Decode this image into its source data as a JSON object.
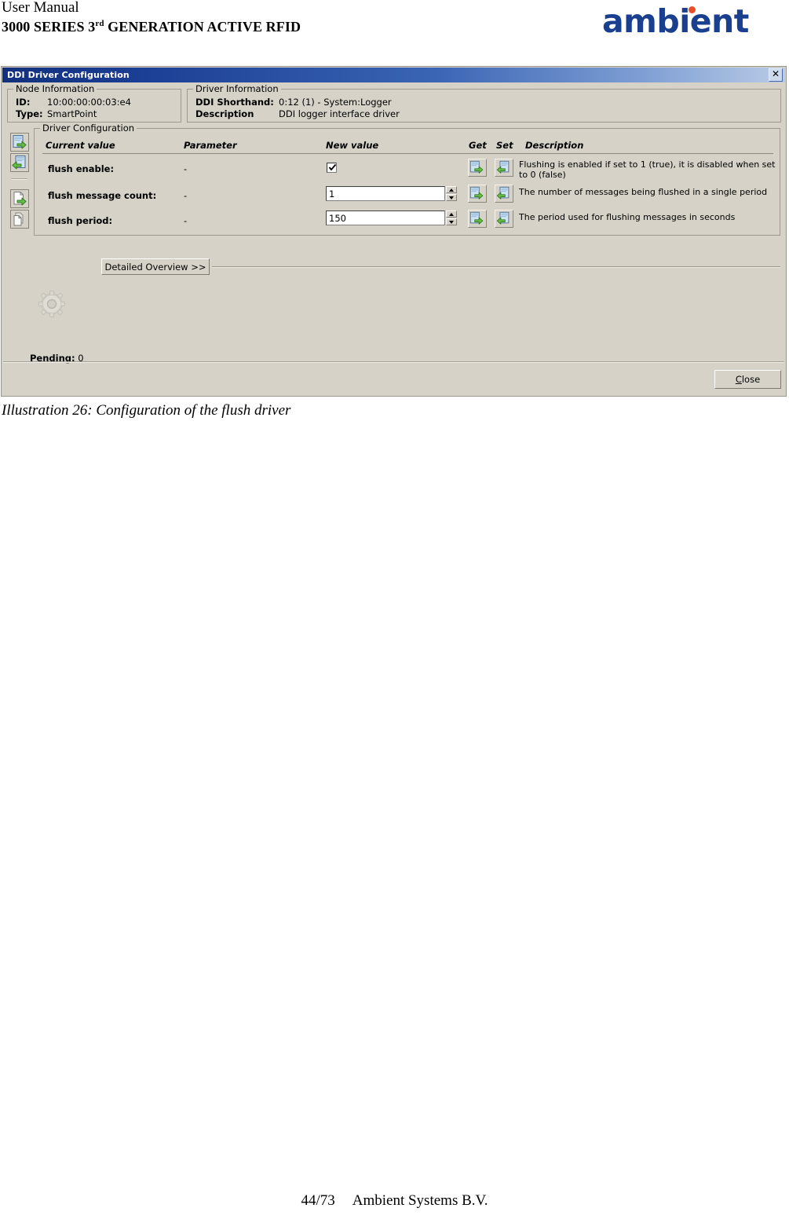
{
  "page": {
    "header_line1": "User Manual",
    "header_line2_prefix": "3000 SERIES 3",
    "header_line2_sup": "rd",
    "header_line2_suffix": " GENERATION ACTIVE RFID",
    "logo_text": "ambient",
    "logo_color": "#1b3f8f",
    "logo_dot_color": "#e8502a",
    "caption": "Illustration 26: Configuration of the flush driver",
    "footer_page": "44/73",
    "footer_company": "Ambient Systems B.V."
  },
  "dialog": {
    "title": "DDI Driver Configuration",
    "close_icon_label": "✕",
    "titlebar_color": "#1b3f94",
    "face_color": "#d6d2c8",
    "node_information": {
      "legend": "Node Information",
      "rows": [
        {
          "key": "ID:",
          "value": "10:00:00:00:03:e4"
        },
        {
          "key": "Type:",
          "value": "SmartPoint"
        }
      ]
    },
    "driver_information": {
      "legend": "Driver Information",
      "rows": [
        {
          "key": "DDI Shorthand:",
          "value": "0:12 (1) - System:Logger"
        },
        {
          "key": "Description",
          "value": "DDI logger interface driver"
        }
      ]
    },
    "toolbar": {
      "buttons": [
        {
          "name": "get-all-button",
          "icon": "page-right-arrow-icon"
        },
        {
          "name": "set-all-button",
          "icon": "page-left-arrow-icon"
        },
        {
          "name": "export-button",
          "icon": "document-right-arrow-icon"
        },
        {
          "name": "copy-button",
          "icon": "copy-pages-icon"
        }
      ]
    },
    "driver_configuration": {
      "legend": "Driver Configuration",
      "columns": [
        "Current value",
        "Parameter",
        "New value",
        "Get",
        "Set",
        "Description"
      ],
      "rows": [
        {
          "current_value": "flush enable:",
          "parameter": "-",
          "new_value": "",
          "control": "checkbox",
          "checked": true,
          "description": "Flushing is enabled if set to 1 (true), it is disabled when set to 0 (false)",
          "get_icon": "page-right-arrow-icon",
          "set_icon": "page-left-arrow-icon"
        },
        {
          "current_value": "flush message count:",
          "parameter": "-",
          "new_value": "1",
          "control": "spinner",
          "checked": false,
          "description": "The number of messages being flushed in a single period",
          "get_icon": "page-right-arrow-icon",
          "set_icon": "page-left-arrow-icon"
        },
        {
          "current_value": "flush period:",
          "parameter": "-",
          "new_value": "150",
          "control": "spinner",
          "checked": false,
          "description": "The period used for flushing messages in seconds",
          "get_icon": "page-right-arrow-icon",
          "set_icon": "page-left-arrow-icon"
        }
      ]
    },
    "detailed_overview_label": "Detailed Overview >>",
    "busy_icon": "gear-icon",
    "pending_label": "Pending:",
    "pending_value": "0",
    "close_button_label": "Close",
    "close_button_accel": "C"
  }
}
